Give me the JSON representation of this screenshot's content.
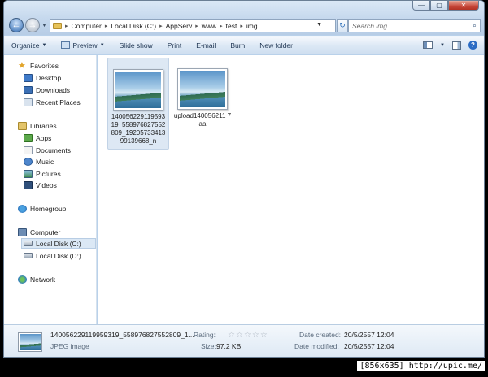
{
  "window": {
    "minimize": "—",
    "maximize": "▢",
    "close": "✕"
  },
  "address": {
    "crumbs": [
      "Computer",
      "Local Disk (C:)",
      "AppServ",
      "www",
      "test",
      "img"
    ],
    "search_placeholder": "Search img"
  },
  "toolbar": {
    "organize": "Organize",
    "preview": "Preview",
    "slideshow": "Slide show",
    "print": "Print",
    "email": "E-mail",
    "burn": "Burn",
    "new_folder": "New folder"
  },
  "nav": {
    "favorites": "Favorites",
    "desktop": "Desktop",
    "downloads": "Downloads",
    "recent": "Recent Places",
    "libraries": "Libraries",
    "apps": "Apps",
    "documents": "Documents",
    "music": "Music",
    "pictures": "Pictures",
    "videos": "Videos",
    "homegroup": "Homegroup",
    "computer": "Computer",
    "local_c": "Local Disk (C:)",
    "local_d": "Local Disk (D:)",
    "network": "Network"
  },
  "files": [
    {
      "name": "140056229119593 19_558976827552 809_19205733413 99139668_n"
    },
    {
      "name": "upload140056211 7aa"
    }
  ],
  "details": {
    "filename": "140056229119959319_558976827552809_1...",
    "type": "JPEG image",
    "rating_label": "Rating:",
    "size_label": "Size:",
    "size_value": "97.2 KB",
    "created_label": "Date created:",
    "created_value": "20/5/2557 12:04",
    "modified_label": "Date modified:",
    "modified_value": "20/5/2557 12:04"
  },
  "overlay": {
    "text": "[856x635] http://upic.me/"
  }
}
